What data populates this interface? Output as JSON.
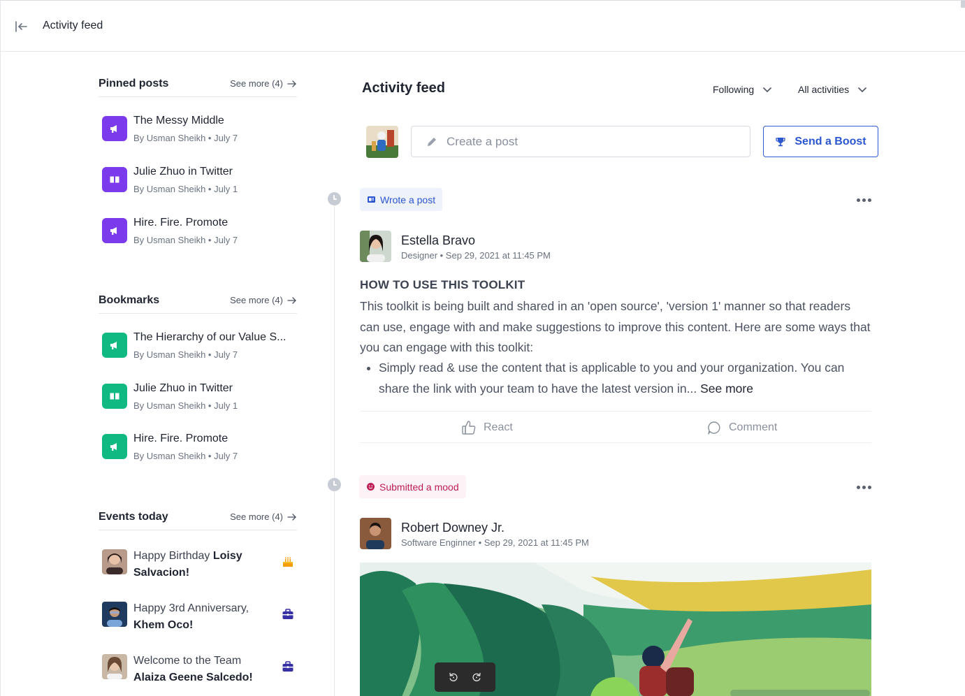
{
  "topbar": {
    "title": "Activity feed"
  },
  "pinned": {
    "title": "Pinned posts",
    "see_more": "See more (4)",
    "items": [
      {
        "title": "The Messy Middle",
        "meta": "By Usman Sheikh • July 7",
        "icon": "megaphone-icon"
      },
      {
        "title": "Julie Zhuo in Twitter",
        "meta": "By Usman Sheikh • July 1",
        "icon": "book-icon"
      },
      {
        "title": "Hire. Fire. Promote",
        "meta": "By Usman Sheikh • July 7",
        "icon": "megaphone-icon"
      }
    ]
  },
  "bookmarks": {
    "title": "Bookmarks",
    "see_more": "See more (4)",
    "items": [
      {
        "title": "The Hierarchy of our Value S...",
        "meta": "By Usman Sheikh • July 7",
        "icon": "megaphone-icon"
      },
      {
        "title": "Julie Zhuo in Twitter",
        "meta": "By Usman Sheikh • July 1",
        "icon": "book-icon"
      },
      {
        "title": "Hire. Fire. Promote",
        "meta": "By Usman Sheikh • July 7",
        "icon": "megaphone-icon"
      }
    ]
  },
  "events": {
    "title": "Events today",
    "see_more": "See more (4)",
    "items": [
      {
        "prefix": "Happy Birthday ",
        "name": "Loisy Salvacion!",
        "icon": "cake-icon"
      },
      {
        "prefix": "Happy 3rd Anniversary, ",
        "name": "Khem Oco!",
        "icon": "briefcase-icon"
      },
      {
        "prefix": "Welcome to the Team ",
        "name": "Alaiza Geene Salcedo!",
        "icon": "briefcase-icon"
      }
    ]
  },
  "feed": {
    "title": "Activity feed",
    "filter_following": "Following",
    "filter_activities": "All activities",
    "create_post_placeholder": "Create a post",
    "boost_label": "Send a Boost",
    "posts": [
      {
        "tag": "Wrote a post",
        "author": "Estella Bravo",
        "meta": "Designer • Sep 29, 2021 at 11:45 PM",
        "heading": "HOW TO USE THIS TOOLKIT",
        "body": "This toolkit is being built and shared in an 'open source', 'version 1' manner so that readers can use, engage with and make suggestions to improve this content. Here are some ways that you can engage with this toolkit:",
        "bullet": "Simply read & use the content that is applicable to you and your organization. You can share the link with your team to have the latest version in...",
        "see_more": "See more",
        "react": "React",
        "comment": "Comment"
      },
      {
        "tag": "Submitted a mood",
        "author": "Robert Downey Jr.",
        "meta": "Software Enginner • Sep 29, 2021 at 11:45 PM"
      }
    ]
  },
  "colors": {
    "accent_blue": "#2b56d0",
    "pinned_purple": "#7c3aed",
    "bookmark_green": "#10b981",
    "mood_pink": "#be1d55"
  }
}
